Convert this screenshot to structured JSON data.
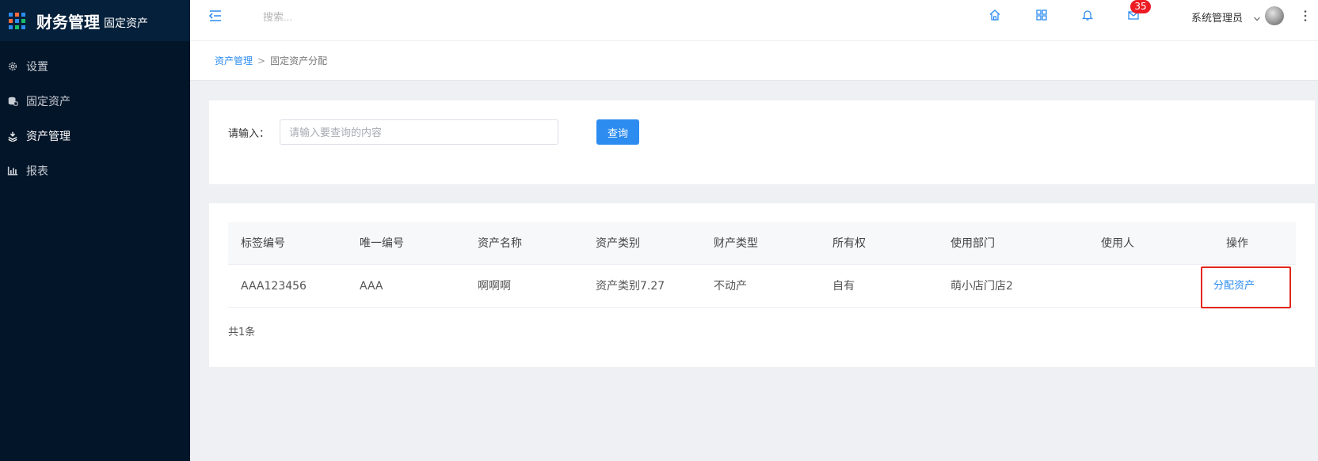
{
  "sidebar": {
    "brand_title": "财务管理",
    "brand_subtitle": "固定资产",
    "items": [
      {
        "label": "设置",
        "icon": "gear-icon"
      },
      {
        "label": "固定资产",
        "icon": "database-icon"
      },
      {
        "label": "资产管理",
        "icon": "stack-icon",
        "active": true
      },
      {
        "label": "报表",
        "icon": "bar-chart-icon"
      }
    ]
  },
  "header": {
    "search_placeholder": "搜索...",
    "mail_badge": "35",
    "user_name": "系统管理员"
  },
  "breadcrumb": {
    "parent": "资产管理",
    "separator": ">",
    "current": "固定资产分配"
  },
  "query": {
    "label": "请输入：",
    "placeholder": "请输入要查询的内容",
    "button": "查询"
  },
  "table": {
    "columns": [
      "标签编号",
      "唯一编号",
      "资产名称",
      "资产类别",
      "财产类型",
      "所有权",
      "使用部门",
      "使用人",
      "操作"
    ],
    "rows": [
      {
        "tag_no": "AAA123456",
        "unique_no": "AAA",
        "asset_name": "啊啊啊",
        "asset_category": "资产类别7.27",
        "property_type": "不动产",
        "ownership": "自有",
        "department": "萌小店门店2",
        "user": "",
        "action": "分配资产"
      }
    ],
    "total": "共1条"
  },
  "colors": {
    "sidebar_bg": "#031529",
    "accent": "#2d8cf0",
    "badge": "#ed1c24",
    "highlight": "#e1251b"
  }
}
